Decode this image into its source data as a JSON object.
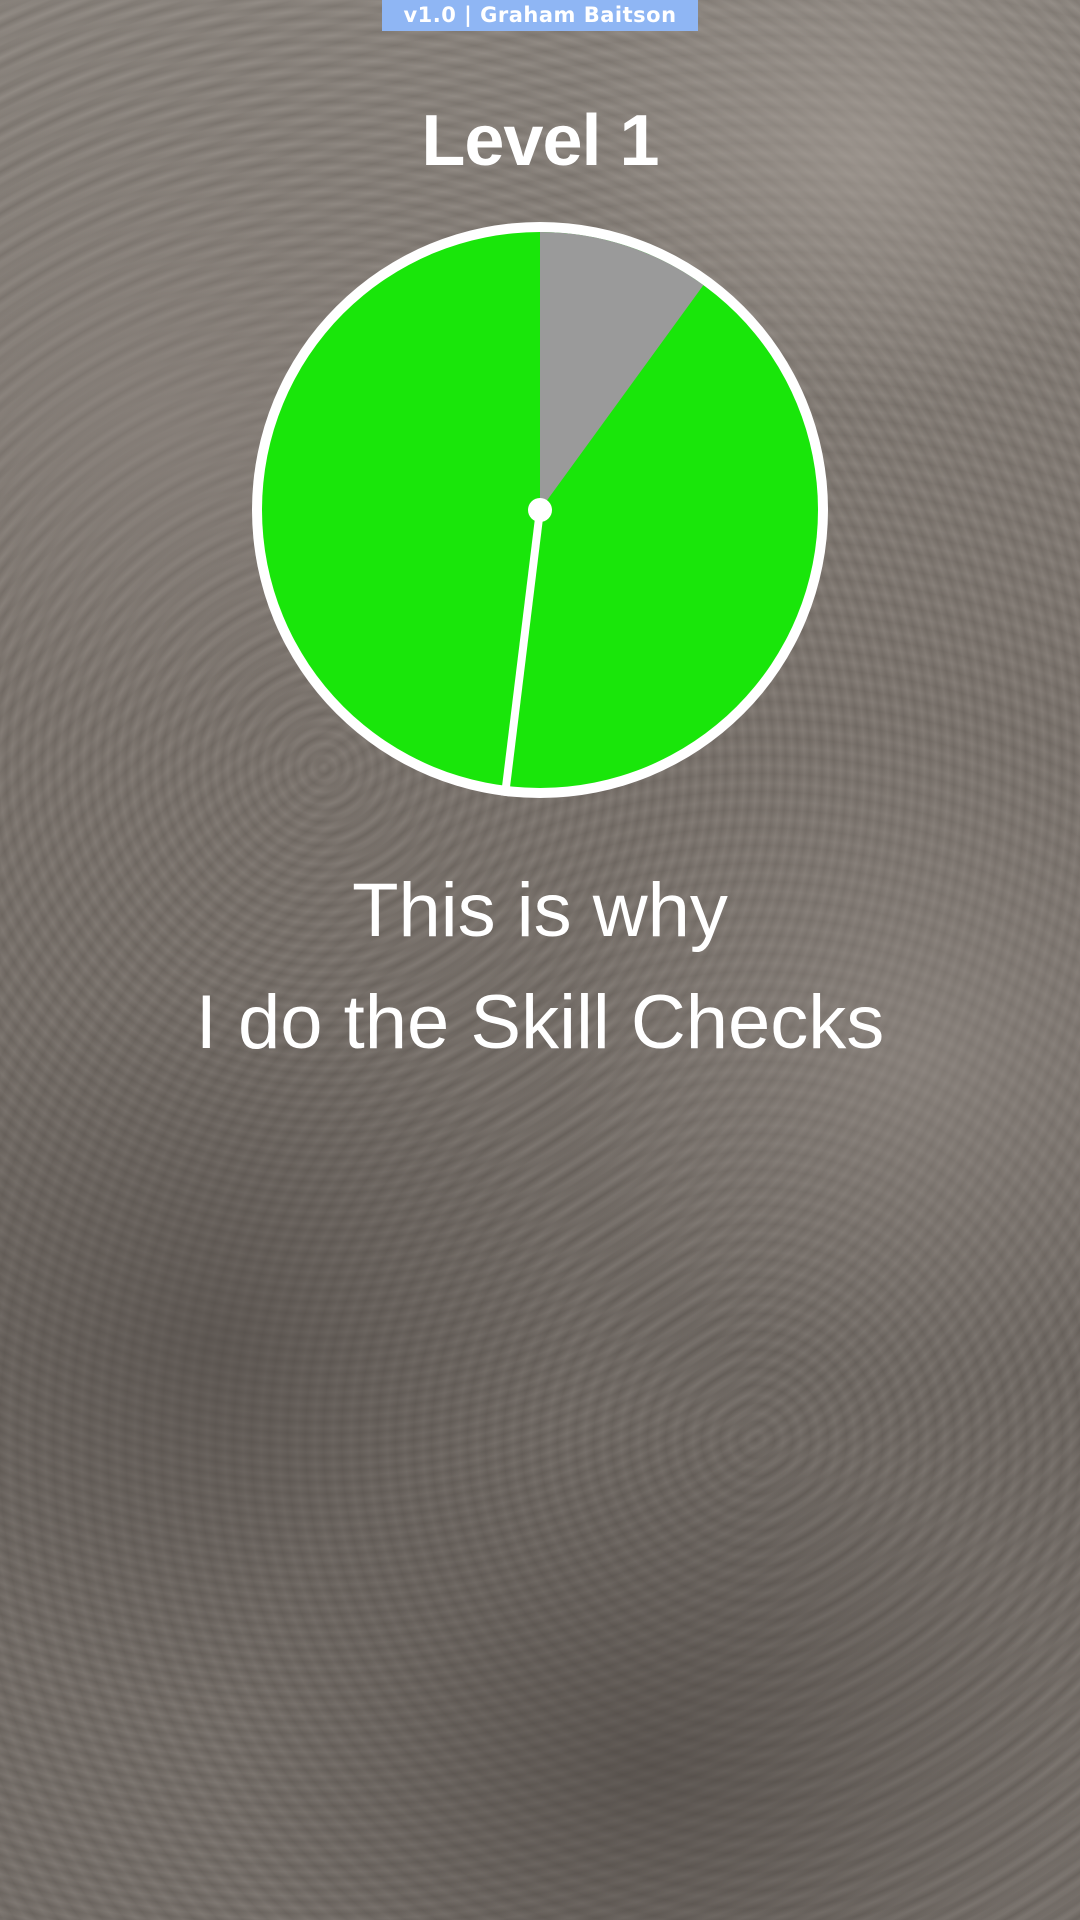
{
  "version_tag": "v1.0 | Graham Baitson",
  "level_title": "Level 1",
  "caption": {
    "line1": "This is why",
    "line2": "I do the Skill Checks"
  },
  "skill_check": {
    "gray_zone_degrees": [
      0,
      36
    ],
    "needle_angle_degrees": 187,
    "colors": {
      "success_zone": "#19e60a",
      "gray_zone": "#9a9a9a",
      "ring": "#ffffff",
      "needle": "#ffffff"
    }
  }
}
